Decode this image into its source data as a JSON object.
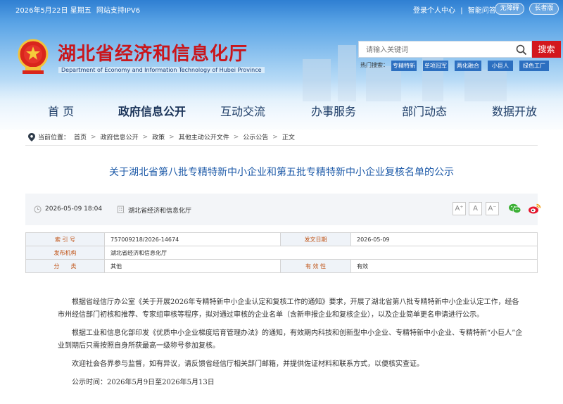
{
  "topbar": {
    "date": "2026年5月22日 星期五",
    "ipv6": "网站支持IPV6",
    "login": "登录个人中心",
    "separator": "|",
    "smart_qa": "智能问答",
    "accessible": "无障碍",
    "elder": "长者版"
  },
  "site": {
    "title": "湖北省经济和信息化厅",
    "subtitle": "Department of Economy and Information Technology of Hubei Province"
  },
  "search": {
    "placeholder": "请输入关键词",
    "button": "搜索",
    "hot_label": "热门搜索：",
    "hot_tags": [
      "专精特新",
      "单项冠军",
      "两化融合",
      "小巨人",
      "绿色工厂"
    ]
  },
  "nav": {
    "items": [
      "首 页",
      "政府信息公开",
      "互动交流",
      "办事服务",
      "部门动态",
      "数据开放"
    ],
    "active_index": 1
  },
  "breadcrumb": {
    "label": "当前位置：",
    "items": [
      "首页",
      "政府信息公开",
      "政策",
      "其他主动公开文件",
      "公示公告",
      "正文"
    ],
    "sep": ">"
  },
  "article": {
    "title": "关于湖北省第八批专精特新中小企业和第五批专精特新中小企业复核名单的公示",
    "datetime": "2026-05-09 18:04",
    "source": "湖北省经济和信息化厅",
    "font_sizes": [
      "A⁺",
      "A",
      "A⁻"
    ]
  },
  "info_table": {
    "index_label": "索 引 号",
    "index_value": "757009218/2026-14674",
    "date_label": "发文日期",
    "date_value": "2026-05-09",
    "org_label": "发布机构",
    "org_value": "湖北省经济和信息化厅",
    "category_label": "分　　类",
    "category_value": "其他",
    "validity_label": "有 效 性",
    "validity_value": "有效"
  },
  "body": {
    "p1": "根据省经信厅办公室《关于开展2026年专精特新中小企业认定和复核工作的通知》要求，开展了湖北省第八批专精特新中小企业认定工作，经各市州经信部门初核和推荐、专家组审核等程序，拟对通过审核的企业名单（含新申报企业和复核企业），以及企业简单更名申请进行公示。",
    "p2": "根据工业和信息化部印发《优质中小企业梯度培育管理办法》的通知，有效期内科技和创新型中小企业、专精特新中小企业、专精特新“小巨人”企业到期后只需按照自身所获最高一级称号参加复核。",
    "p3": "欢迎社会各界参与监督，如有异议，请反馈省经信厅相关部门邮箱，并提供佐证材料和联系方式，以便核实查证。",
    "p4": "公示时间：2026年5月9日至2026年5月13日"
  },
  "colors": {
    "brand_red": "#c9161c",
    "nav_text": "#1f3e68",
    "title_blue": "#1d5aa8",
    "label_orange": "#c1561a"
  }
}
